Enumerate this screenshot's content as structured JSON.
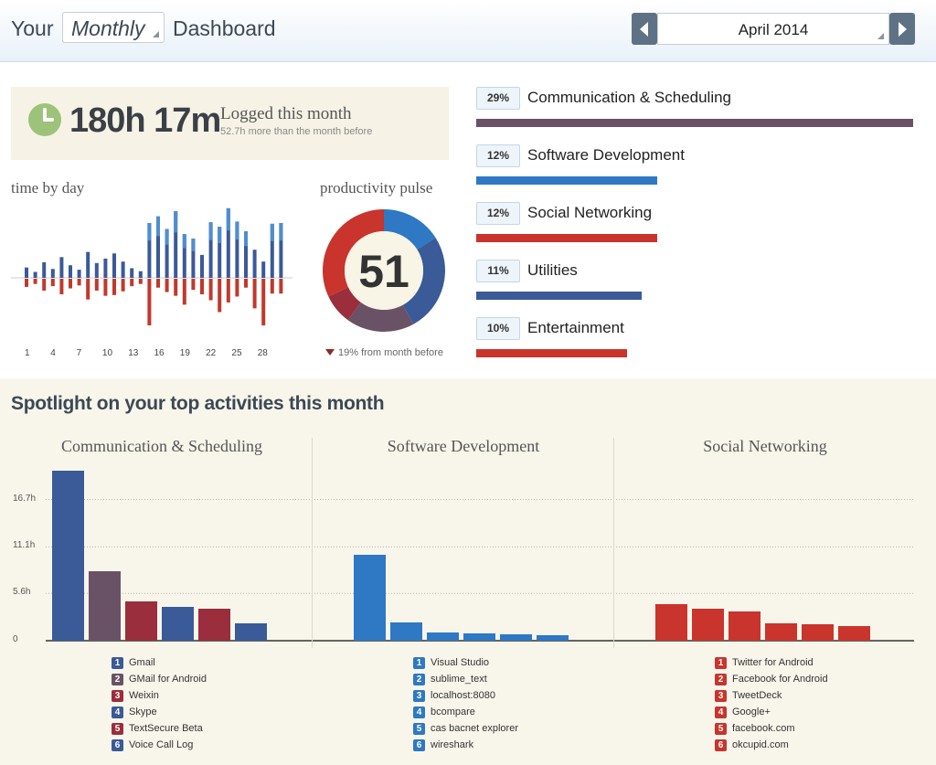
{
  "header": {
    "your_label": "Your",
    "period": "Monthly",
    "dashboard_label": "Dashboard",
    "month": "April 2014"
  },
  "summary": {
    "logged_value": "180h 17m",
    "logged_label": "Logged this month",
    "logged_sub": "52.7h more than the month before"
  },
  "time_by_day": {
    "title": "time by day",
    "tick_labels": [
      "1",
      "4",
      "7",
      "10",
      "13",
      "16",
      "19",
      "22",
      "25",
      "28"
    ],
    "chart_data": {
      "type": "bar",
      "x": [
        1,
        2,
        3,
        4,
        5,
        6,
        7,
        8,
        9,
        10,
        11,
        12,
        13,
        14,
        15,
        16,
        17,
        18,
        19,
        20,
        21,
        22,
        23,
        24,
        25,
        26,
        27,
        28,
        29,
        30
      ],
      "series": [
        {
          "values": [
            1.4,
            0.8,
            2.1,
            1.2,
            2.8,
            1.7,
            1.1,
            3.5,
            2.0,
            2.6,
            3.3,
            2.2,
            1.3,
            0.9,
            7.4,
            8.3,
            6.6,
            9.0,
            5.9,
            5.3,
            3.1,
            7.5,
            6.9,
            9.4,
            7.6,
            6.3,
            3.8,
            2.2,
            7.3,
            7.4
          ]
        },
        {
          "values": [
            1.1,
            0.7,
            1.6,
            1.0,
            2.1,
            1.3,
            0.9,
            2.8,
            1.6,
            2.3,
            2.2,
            1.7,
            1.0,
            0.7,
            6.3,
            1.2,
            1.8,
            2.3,
            3.5,
            1.5,
            2.1,
            2.9,
            4.5,
            3.2,
            2.4,
            1.2,
            4.0,
            6.3,
            2.0,
            2.0
          ]
        }
      ],
      "colors": {
        "top": "#3a5a98",
        "top_light": "#4f8ed0",
        "bottom": "#c0392b"
      }
    }
  },
  "pulse": {
    "title": "productivity pulse",
    "value": "51",
    "change": "19% from month before",
    "chart_data": {
      "type": "pie",
      "slices": [
        {
          "value": 16,
          "color": "#2e78c4"
        },
        {
          "value": 26,
          "color": "#3a5a98"
        },
        {
          "value": 18,
          "color": "#6a5266"
        },
        {
          "value": 8,
          "color": "#9a2e3c"
        },
        {
          "value": 32,
          "color": "#c9342d"
        }
      ]
    }
  },
  "categories": [
    {
      "pct": "29%",
      "name": "Communication & Scheduling",
      "share": 29,
      "color": "#6a5266"
    },
    {
      "pct": "12%",
      "name": "Software Development",
      "share": 12,
      "color": "#2e78c4"
    },
    {
      "pct": "12%",
      "name": "Social Networking",
      "share": 12,
      "color": "#c9342d"
    },
    {
      "pct": "11%",
      "name": "Utilities",
      "share": 11,
      "color": "#3a5a98"
    },
    {
      "pct": "10%",
      "name": "Entertainment",
      "share": 10,
      "color": "#c9342d"
    }
  ],
  "spotlight": {
    "title": "Spotlight on your top activities this month",
    "y_ticks": [
      "16.7h",
      "11.1h",
      "5.6h",
      "0"
    ],
    "chart_data": [
      {
        "type": "bar",
        "title": "Communication & Scheduling",
        "categories": [
          "Gmail",
          "GMail for Android",
          "Weixin",
          "Skype",
          "TextSecure Beta",
          "Voice Call Log"
        ],
        "values": [
          20.1,
          8.2,
          4.7,
          4.0,
          3.8,
          2.1
        ],
        "colors": [
          "#3a5a98",
          "#6a5266",
          "#9a2e3c",
          "#3a5a98",
          "#9a2e3c",
          "#3a5a98"
        ],
        "ylim": [
          0,
          22
        ]
      },
      {
        "type": "bar",
        "title": "Software Development",
        "categories": [
          "Visual Studio",
          "sublime_text",
          "localhost:8080",
          "bcompare",
          "cas bacnet explorer",
          "wireshark"
        ],
        "values": [
          10.2,
          2.2,
          1.0,
          0.9,
          0.8,
          0.6
        ],
        "colors": [
          "#2e78c4",
          "#2e78c4",
          "#2e78c4",
          "#2e78c4",
          "#2e78c4",
          "#2e78c4"
        ],
        "ylim": [
          0,
          22
        ]
      },
      {
        "type": "bar",
        "title": "Social Networking",
        "categories": [
          "Twitter for Android",
          "Facebook for Android",
          "TweetDeck",
          "Google+",
          "facebook.com",
          "okcupid.com"
        ],
        "values": [
          4.3,
          3.8,
          3.5,
          2.1,
          1.9,
          1.7
        ],
        "colors": [
          "#c9342d",
          "#c9342d",
          "#c9342d",
          "#c9342d",
          "#c9342d",
          "#c9342d"
        ],
        "ylim": [
          0,
          22
        ]
      }
    ]
  }
}
